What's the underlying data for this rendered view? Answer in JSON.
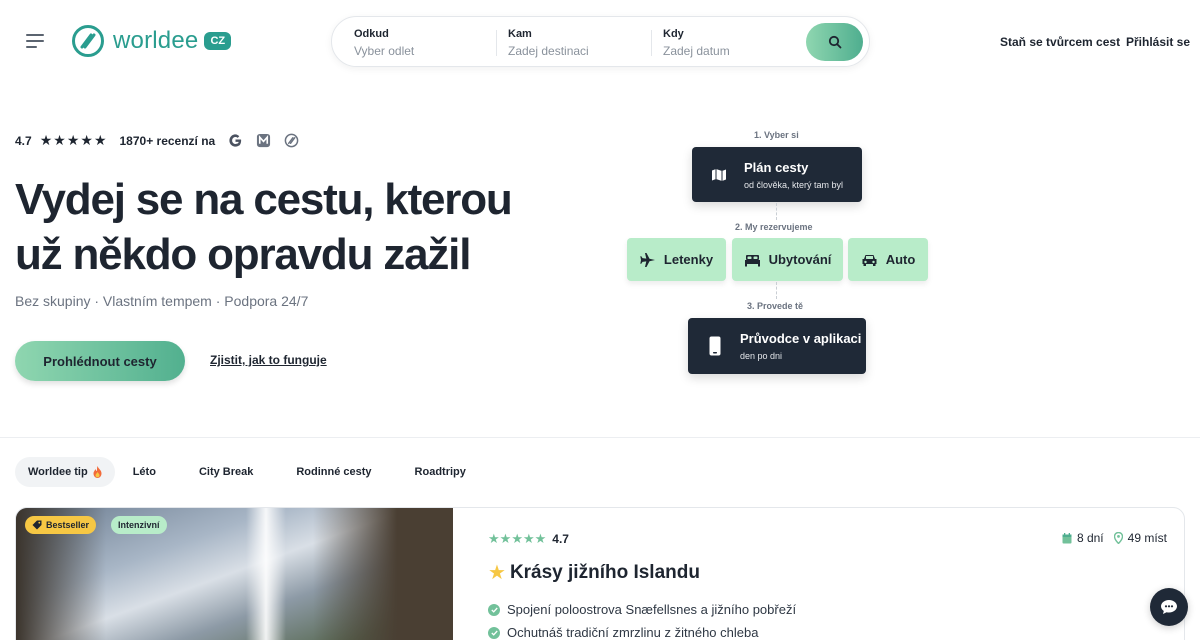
{
  "header": {
    "logo_text": "worldee",
    "logo_badge": "CZ",
    "search": {
      "from": {
        "label": "Odkud",
        "placeholder": "Vyber odlet"
      },
      "to": {
        "label": "Kam",
        "placeholder": "Zadej destinaci"
      },
      "when": {
        "label": "Kdy",
        "placeholder": "Zadej datum"
      },
      "button_icon": "search-icon"
    },
    "creator_link": "Staň se tvůrcem cest",
    "login_link": "Přihlásit se"
  },
  "hero": {
    "rating": "4.7",
    "stars": 5,
    "reviews": "1870+ recenzí na",
    "review_sources": [
      "google-icon",
      "m-icon",
      "worldee-icon"
    ],
    "title_line1": "Vydej se na cestu, kterou",
    "title_line2": "už někdo opravdu zažil",
    "subtitle": "Bez skupiny · Vlastním tempem · Podpora 24/7",
    "cta_button": "Prohlédnout cesty",
    "cta_link": "Zjistit, jak to funguje"
  },
  "steps": {
    "step1_label": "1. Vyber si",
    "step1_title": "Plán cesty",
    "step1_desc": "od člověka, který tam byl",
    "step2_label": "2. My rezervujeme",
    "flights": "Letenky",
    "accommodation": "Ubytování",
    "car": "Auto",
    "step3_label": "3. Provede tě",
    "step3_title": "Průvodce v aplikaci",
    "step3_desc": "den po dni"
  },
  "tabs": [
    {
      "label": "Worldee tip",
      "active": true
    },
    {
      "label": "Léto"
    },
    {
      "label": "City Break"
    },
    {
      "label": "Rodinné cesty"
    },
    {
      "label": "Roadtripy"
    }
  ],
  "trip": {
    "badge_bestseller": "Bestseller",
    "badge_intensity": "Intenzivní",
    "rating": "4.7",
    "days": "8 dní",
    "places": "49 míst",
    "title": "Krásy jižního Islandu",
    "features": [
      "Spojení poloostrova Snæfellsnes a jižního pobřeží",
      "Ochutnáš tradiční zmrzlinu z žitného chleba"
    ]
  },
  "colors": {
    "brand": "#2a9d8f",
    "accent_green": "#b8ecc9",
    "dark": "#1f2937",
    "star_yellow": "#f6c744"
  }
}
